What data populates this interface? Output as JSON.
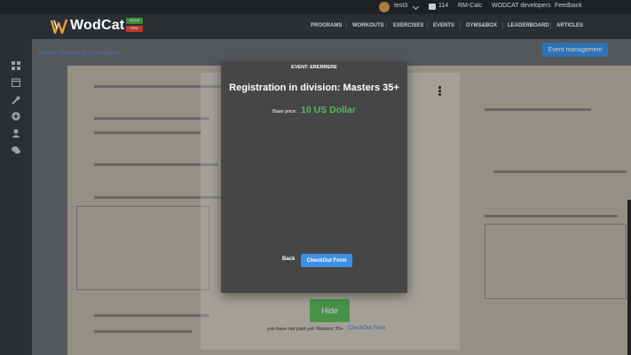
{
  "topbar": {
    "username": "test3",
    "count": "114",
    "rmcalc": "RM-Calc",
    "developers": "WODCAT developers",
    "feedback": "Feedback"
  },
  "brand": {
    "name": "WodCat",
    "version_badge": "v2.9.9",
    "pro_badge": "PRO"
  },
  "nav": {
    "items": [
      "PROGRAMS",
      "WORKOUTS",
      "EXERCISES",
      "EVENTS",
      "GYMS&BOX",
      "LEADERBOARD",
      "ARTICLES"
    ]
  },
  "page": {
    "breadcrumb": "Home / Events & Competition",
    "management_button": "Event management",
    "hide_button": "Hide",
    "not_paid": "you have not paid yet: Masters 35+",
    "checkout_link": "CheckOut Form"
  },
  "modal": {
    "event_label": "EVENT: ERERRERE",
    "title": "Registration in division: Masters 35+",
    "price_label": "Base price:",
    "price_value": "10 US Dollar",
    "back": "Back",
    "checkout": "CheckOut Form"
  },
  "colors": {
    "accent_blue": "#3d8fe3",
    "price_green": "#5cb85c",
    "modal_bg": "#464646",
    "header_bg": "#2b2f33"
  },
  "icons": {
    "sidebar": [
      "dashboard-icon",
      "calendar-icon",
      "wrench-icon",
      "plus-circle-icon",
      "user-icon",
      "chat-icon"
    ]
  }
}
